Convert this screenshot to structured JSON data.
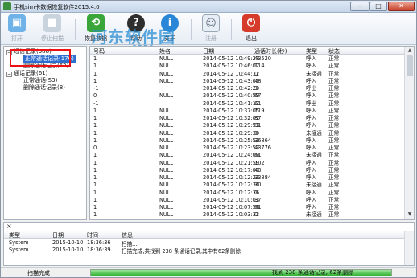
{
  "window": {
    "title": "手机sim卡数据恢复软件2015.4.0"
  },
  "watermark": {
    "line1": "河东软件园",
    "line2": "www.pc0359.cn"
  },
  "toolbar": {
    "open": "打开",
    "scan": "停止扫描",
    "recover": "恢复数据",
    "help": "帮助",
    "about": "关于",
    "register": "注册",
    "exit": "退出"
  },
  "tree": {
    "root": "短信记录(388)",
    "root_children": [
      "正常通话记录(176)",
      "删除通话记录(62)"
    ],
    "calls": "通话记录(61)",
    "calls_children": [
      "正常通话(53)",
      "删除通话记录(8)"
    ]
  },
  "grid": {
    "columns": [
      "号码",
      "姓名",
      "日期",
      "通话时长(秒)",
      "类型",
      "状态"
    ],
    "rows": [
      {
        "num": "1",
        "name": "NULL",
        "date": "2014-05-12 10:49:28",
        "dur": "43520",
        "type": "呼入",
        "status": "正常"
      },
      {
        "num": "1",
        "name": "NULL",
        "date": "2014-05-12 10:46:02",
        "dur": "114",
        "type": "呼入",
        "status": "正常"
      },
      {
        "num": "1",
        "name": "NULL",
        "date": "2014-05-12 10:44:12",
        "dur": "0",
        "type": "未接通",
        "status": "正常"
      },
      {
        "num": "1",
        "name": "NULL",
        "date": "2014-05-12 10:43:03",
        "dur": "48",
        "type": "呼入",
        "status": "正常"
      },
      {
        "num": "-1",
        "name": "",
        "date": "2014-05-12 10:42:20",
        "dur": "3",
        "type": "呼出",
        "status": "正常"
      },
      {
        "num": "0",
        "name": "NULL",
        "date": "2014-05-12 10:40:59",
        "dur": "67",
        "type": "呼入",
        "status": "正常"
      },
      {
        "num": "-1",
        "name": "",
        "date": "2014-05-12 10:41:12",
        "dur": "61",
        "type": "呼出",
        "status": "正常"
      },
      {
        "num": "1",
        "name": "NULL",
        "date": "2014-05-12 10:37:05",
        "dur": "119",
        "type": "呼入",
        "status": "正常"
      },
      {
        "num": "1",
        "name": "NULL",
        "date": "2014-05-12 10:32:02",
        "dur": "87",
        "type": "呼入",
        "status": "正常"
      },
      {
        "num": "1",
        "name": "NULL",
        "date": "2014-05-12 10:29:53",
        "dur": "81",
        "type": "呼入",
        "status": "正常"
      },
      {
        "num": "1",
        "name": "NULL",
        "date": "2014-05-12 10:29:30",
        "dur": "0",
        "type": "未接通",
        "status": "正常"
      },
      {
        "num": "1",
        "name": "NULL",
        "date": "2014-05-12 10:25:53",
        "dur": "36864",
        "type": "呼入",
        "status": "正常"
      },
      {
        "num": "0",
        "name": "NULL",
        "date": "2014-05-12 10:23:53",
        "dur": "43776",
        "type": "呼入",
        "status": "正常"
      },
      {
        "num": "1",
        "name": "NULL",
        "date": "2014-05-12 10:24:00",
        "dur": "61",
        "type": "未接通",
        "status": "正常"
      },
      {
        "num": "1",
        "name": "NULL",
        "date": "2014-05-12 10:21:59",
        "dur": "102",
        "type": "呼入",
        "status": "正常"
      },
      {
        "num": "1",
        "name": "NULL",
        "date": "2014-05-12 10:17:08",
        "dur": "43",
        "type": "呼入",
        "status": "正常"
      },
      {
        "num": "1",
        "name": "NULL",
        "date": "2014-05-12 10:12:23",
        "dur": "33884",
        "type": "呼入",
        "status": "正常"
      },
      {
        "num": "1",
        "name": "NULL",
        "date": "2014-05-12 10:12:36",
        "dur": "30",
        "type": "未接通",
        "status": "正常"
      },
      {
        "num": "1",
        "name": "NULL",
        "date": "2014-05-12 10:12:36",
        "dur": "0",
        "type": "呼入",
        "status": "正常"
      },
      {
        "num": "1",
        "name": "NULL",
        "date": "2014-05-12 10:10:03",
        "dur": "37",
        "type": "呼入",
        "status": "正常"
      },
      {
        "num": "1",
        "name": "NULL",
        "date": "2014-05-12 10:07:56",
        "dur": "61",
        "type": "呼入",
        "status": "正常"
      },
      {
        "num": "1",
        "name": "NULL",
        "date": "2014-05-12 10:03:32",
        "dur": "0",
        "type": "未接通",
        "status": "正常"
      }
    ]
  },
  "log": {
    "columns": [
      "类型",
      "日期",
      "时间",
      "信息"
    ],
    "rows": [
      {
        "type": "System",
        "date": "2015-10-10",
        "time": "18:36:36",
        "info": "扫描..."
      },
      {
        "type": "System",
        "date": "2015-10-10",
        "time": "18:36:39",
        "info": "扫描完成,共找到 238 条通话记录,其中有62条删除"
      }
    ],
    "close_glyph": "×"
  },
  "status": {
    "left": "扫描完成",
    "progress_text": "找到 238 条通话记录, 62条删除",
    "progress_fraction": 1.0
  },
  "colors": {
    "accent_green": "#3aa63a",
    "help_icon": "#2e2e2e",
    "about_icon": "#2a86d6",
    "exit_icon": "#d63a2a",
    "highlight_box": "#ee1111"
  }
}
